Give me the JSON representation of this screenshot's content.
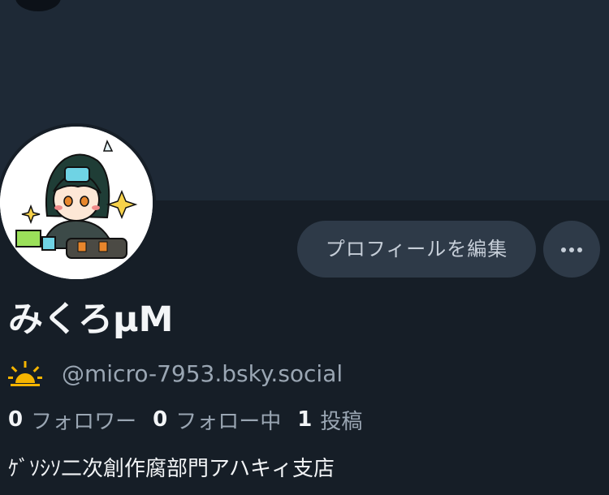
{
  "profile": {
    "display_name": "みくろμM",
    "handle": "@micro-7953.bsky.social",
    "bio": "ｹﾞｿｼｿ二次創作腐部門アハキィ支店",
    "badge_icon": "sun-icon",
    "avatar_icon": "avatar-illustration"
  },
  "stats": {
    "followers_count": "0",
    "followers_label": "フォロワー",
    "following_count": "0",
    "following_label": "フォロー中",
    "posts_count": "1",
    "posts_label": "投稿"
  },
  "actions": {
    "edit_profile_label": "プロフィールを編集",
    "more_icon": "more-icon"
  },
  "colors": {
    "background": "#161e27",
    "banner": "#1e2936",
    "button": "#2e3a48",
    "muted_text": "#9aa6b3",
    "sun": "#f5b400"
  }
}
